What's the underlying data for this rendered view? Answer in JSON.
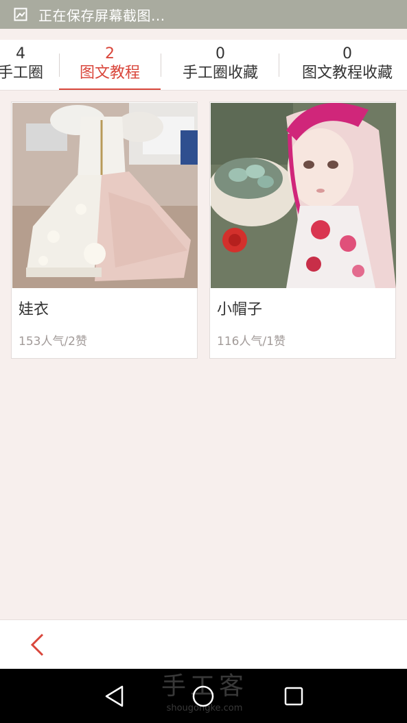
{
  "status_bar": {
    "text": "正在保存屏幕截图...",
    "icon": "screenshot-icon"
  },
  "tabs": [
    {
      "count": "4",
      "label": "手工圈",
      "active": false
    },
    {
      "count": "2",
      "label": "图文教程",
      "active": true
    },
    {
      "count": "0",
      "label": "手工圈收藏",
      "active": false
    },
    {
      "count": "0",
      "label": "图文教程收藏",
      "active": false
    }
  ],
  "cards": [
    {
      "title": "娃衣",
      "stats": "153人气/2赞",
      "image": "doll-dress-photo"
    },
    {
      "title": "小帽子",
      "stats": "116人气/1赞",
      "image": "doll-hat-photo"
    }
  ],
  "app_bar": {
    "back_icon": "chevron-left-icon"
  },
  "nav_bar": {
    "buttons": [
      "back-triangle-icon",
      "home-circle-icon",
      "recents-square-icon"
    ],
    "watermark_cn": "手工客",
    "watermark_en": "shougongke.com"
  },
  "colors": {
    "accent": "#d9463b",
    "page_bg": "#f7efed",
    "status_bg": "#a9ab9f"
  }
}
